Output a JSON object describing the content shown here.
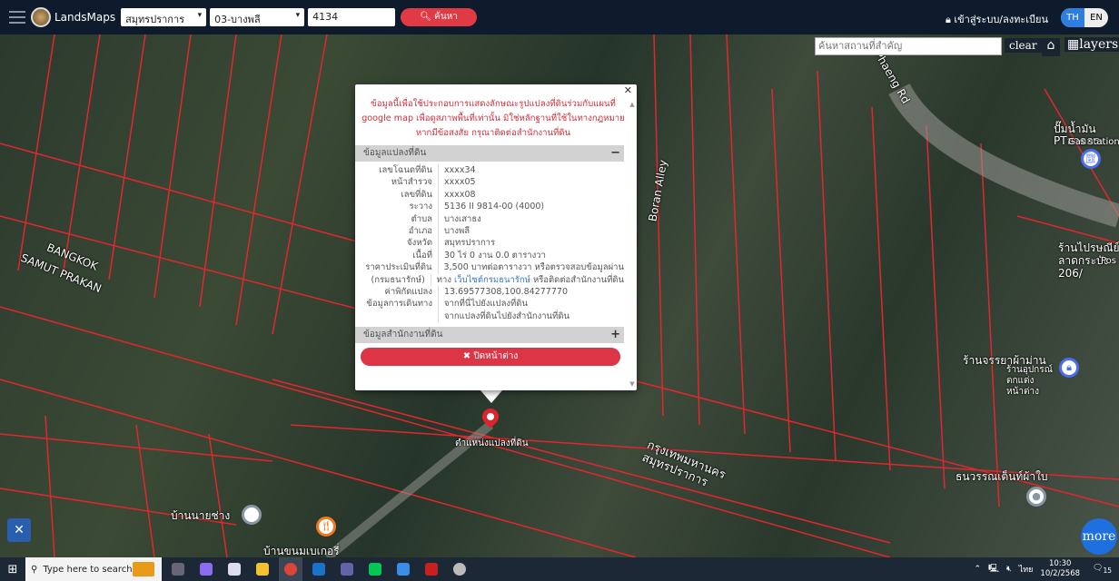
{
  "header": {
    "brand": "LandsMaps",
    "province": "สมุทรปราการ",
    "district": "03-บางพลี",
    "parcel_no": "4134",
    "search_label": "ค้นหา",
    "login_label": "เข้าสู่ระบบ/ลงทะเบียน",
    "lang": [
      "TH",
      "EN"
    ],
    "lang_active": "TH"
  },
  "map_controls": {
    "place_search_placeholder": "ค้นหาสถานที่สำคัญ",
    "clear_label": "clear",
    "layers_label": "layers",
    "more_label": "more"
  },
  "map_labels": [
    "BANGKOK",
    "SAMUT PRAKAN",
    "Boran Alley",
    "Phaeng Rd",
    "ปั๊มน้ำมัน PTลาดกระ",
    "Gas station",
    "ร้านไปรษณีย์ ลาดกระบัง 206/",
    "Pos",
    "ร้านจรรยาผ้าม่าน",
    "ร้านอุปกรณ์ ตกแต่งหน้าต่าง",
    "กรุงเทพมหานคร สมุทรปราการ",
    "ธนวรรณเต็นท์ผ้าใบ",
    "บ้านนายช่าง",
    "บ้านขนมเบเกอรี่",
    "ตำแหน่งแปลงที่ดิน"
  ],
  "popup": {
    "warning": "ข้อมูลนี้เพื่อใช้ประกอบการแสดงลักษณะรูปแปลงที่ดินร่วมกับแผนที่ google map เพื่อดูสภาพพื้นที่เท่านั้น มิใช่หลักฐานที่ใช้ในทางกฎหมาย หากมีข้อสงสัย กรุณาติดต่อสำนักงานที่ดิน",
    "section_parcel": "ข้อมูลแปลงที่ดิน",
    "section_office": "ข้อมูลสำนักงานที่ดิน",
    "rows": [
      {
        "k": "เลขโฉนดที่ดิน",
        "v": "xxxx34"
      },
      {
        "k": "หน้าสำรวจ",
        "v": "xxxx05"
      },
      {
        "k": "เลขที่ดิน",
        "v": "xxxx08"
      },
      {
        "k": "ระวาง",
        "v": "5136 II 9814-00 (4000)"
      },
      {
        "k": "ตำบล",
        "v": "บางเสาธง"
      },
      {
        "k": "อำเภอ",
        "v": "บางพลี"
      },
      {
        "k": "จังหวัด",
        "v": "สมุทรปราการ"
      },
      {
        "k": "เนื้อที่",
        "v": "30 ไร่ 0 งาน 0.0 ตารางวา"
      }
    ],
    "price_label": "ราคาประเมินที่ดิน",
    "price_label2": "(กรมธนารักษ์)",
    "price_text": "3,500 บาทต่อตารางวา หรือตรวจสอบข้อมูลผ่าน",
    "price_pre": "ทาง ",
    "price_link": "เว็บไซต์กรมธนารักษ์",
    "price_post": " หรือติดต่อสำนักงานที่ดิน",
    "coord_label": "ค่าพิกัดแปลง",
    "coord": "13.69577308,100.84277770",
    "route_label": "ข้อมูลการเดินทาง",
    "route1": "จากที่นี่ไปยังแปลงที่ดิน",
    "route2": "จากแปลงที่ดินไปยังสำนักงานที่ดิน",
    "close_label": "ปิดหน้าต่าง"
  },
  "taskbar": {
    "search_placeholder": "Type here to search",
    "time": "10:30",
    "date": "10/2/2568",
    "lang": "ไทย",
    "notif_count": "15"
  }
}
